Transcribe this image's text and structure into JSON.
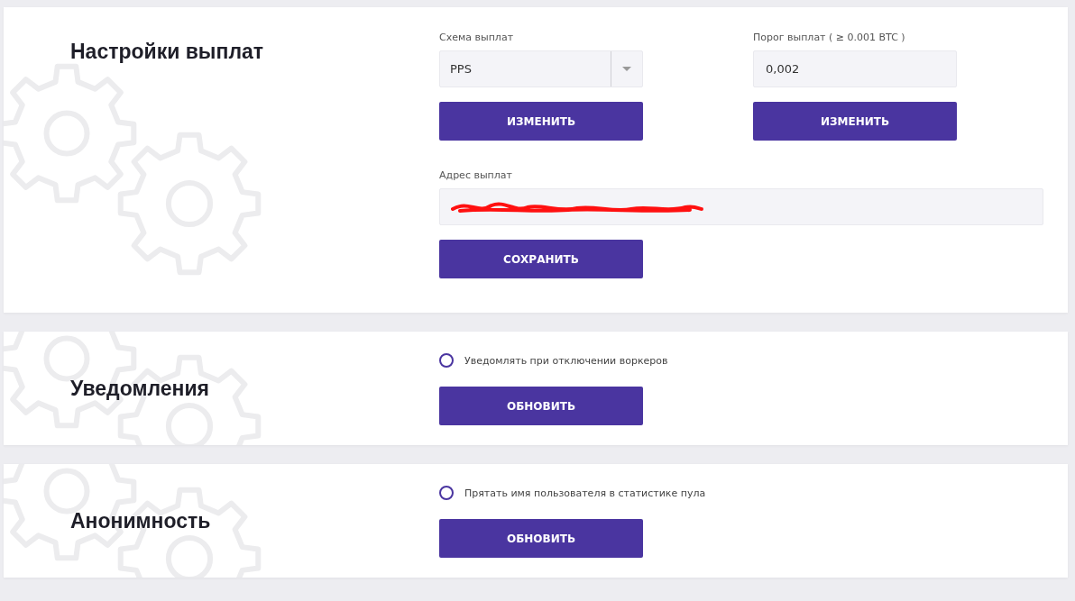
{
  "sections": [
    {
      "kind": "payout",
      "title": "Настройки выплат",
      "scheme": {
        "label": "Схема выплат",
        "value": "PPS",
        "button": "ИЗМЕНИТЬ"
      },
      "threshold": {
        "label": "Порог выплат ( ≥ 0.001 BTC )",
        "value": "0,002",
        "button": "ИЗМЕНИТЬ"
      },
      "address": {
        "label": "Адрес выплат",
        "button": "СОХРАНИТЬ"
      }
    },
    {
      "kind": "option",
      "title": "Уведомления",
      "option": {
        "label": "Уведомлять при отключении воркеров",
        "checked": false
      },
      "button": "ОБНОВИТЬ"
    },
    {
      "kind": "option",
      "title": "Анонимность",
      "option": {
        "label": "Прятать имя пользователя в статистике пула",
        "checked": false
      },
      "button": "ОБНОВИТЬ"
    }
  ]
}
